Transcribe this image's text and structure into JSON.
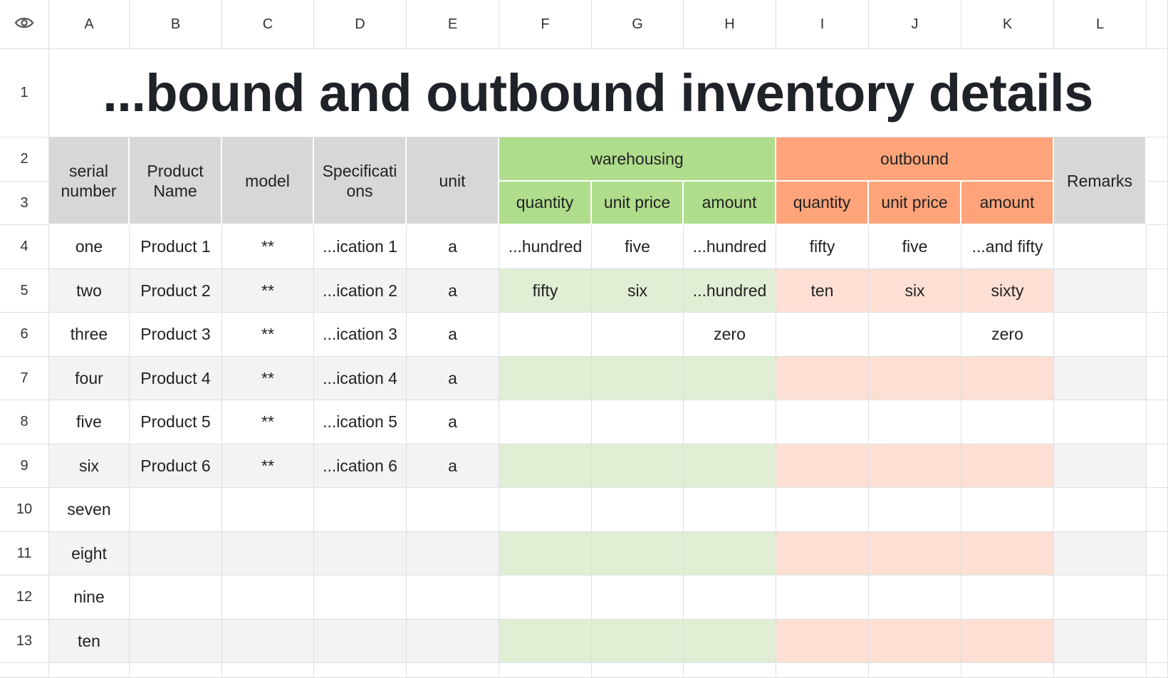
{
  "columns": [
    "A",
    "B",
    "C",
    "D",
    "E",
    "F",
    "G",
    "H",
    "I",
    "J",
    "K",
    "L"
  ],
  "row_numbers": [
    "1",
    "2",
    "3",
    "4",
    "5",
    "6",
    "7",
    "8",
    "9",
    "10",
    "11",
    "12",
    "13"
  ],
  "icons": {
    "corner": "eye-icon"
  },
  "title": "...bound and outbound inventory details",
  "headers": {
    "serial_number": "serial number",
    "product_name": "Product Name",
    "model": "model",
    "specifications": "Specificati ons",
    "unit": "unit",
    "warehousing": "warehousing",
    "outbound": "outbound",
    "remarks": "Remarks",
    "sub": [
      "quantity",
      "unit price",
      "amount",
      "quantity",
      "unit price",
      "amount"
    ]
  },
  "rows": [
    [
      "one",
      "Product 1",
      "**",
      "...ication 1",
      "a",
      "...hundred",
      "five",
      "...hundred",
      "fifty",
      "five",
      "...and fifty",
      ""
    ],
    [
      "two",
      "Product 2",
      "**",
      "...ication 2",
      "a",
      "fifty",
      "six",
      "...hundred",
      "ten",
      "six",
      "sixty",
      ""
    ],
    [
      "three",
      "Product 3",
      "**",
      "...ication 3",
      "a",
      "",
      "",
      "zero",
      "",
      "",
      "zero",
      ""
    ],
    [
      "four",
      "Product 4",
      "**",
      "...ication 4",
      "a",
      "",
      "",
      "",
      "",
      "",
      "",
      ""
    ],
    [
      "five",
      "Product 5",
      "**",
      "...ication 5",
      "a",
      "",
      "",
      "",
      "",
      "",
      "",
      ""
    ],
    [
      "six",
      "Product 6",
      "**",
      "...ication 6",
      "a",
      "",
      "",
      "",
      "",
      "",
      "",
      ""
    ],
    [
      "seven",
      "",
      "",
      "",
      "",
      "",
      "",
      "",
      "",
      "",
      "",
      ""
    ],
    [
      "eight",
      "",
      "",
      "",
      "",
      "",
      "",
      "",
      "",
      "",
      "",
      ""
    ],
    [
      "nine",
      "",
      "",
      "",
      "",
      "",
      "",
      "",
      "",
      "",
      "",
      ""
    ],
    [
      "ten",
      "",
      "",
      "",
      "",
      "",
      "",
      "",
      "",
      "",
      "",
      ""
    ]
  ],
  "colors": {
    "warehousing_header": "#b0dd8b",
    "outbound_header": "#ffa47a",
    "gray_header": "#d7d7d7",
    "alt_row": "#f1f3f5",
    "green_alt": "#e0eed4",
    "orange_alt": "#fde0d3"
  }
}
